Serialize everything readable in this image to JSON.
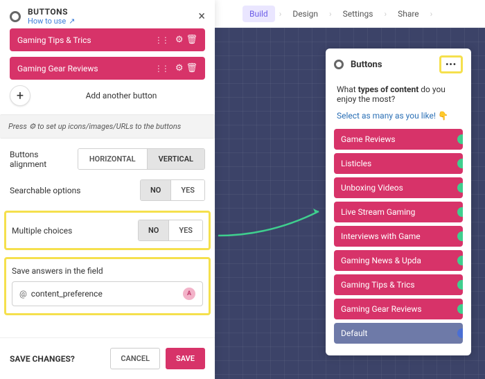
{
  "sidebar": {
    "title": "BUTTONS",
    "howToUse": "How to use",
    "buttons": [
      {
        "label": "Gaming Tips & Trics"
      },
      {
        "label": "Gaming Gear Reviews"
      }
    ],
    "addAnother": "Add another button",
    "hint": "Press ⚙ to set up icons/images/URLs to the buttons",
    "alignment": {
      "label": "Buttons alignment",
      "options": [
        "HORIZONTAL",
        "VERTICAL"
      ],
      "selected": "VERTICAL"
    },
    "searchable": {
      "label": "Searchable options",
      "options": [
        "NO",
        "YES"
      ],
      "selected": "NO"
    },
    "multiple": {
      "label": "Multiple choices",
      "options": [
        "NO",
        "YES"
      ],
      "selected": "YES"
    },
    "saveField": {
      "label": "Save answers in the field",
      "value": "content_preference",
      "badge": "A"
    },
    "footer": {
      "question": "SAVE CHANGES?",
      "cancel": "CANCEL",
      "save": "SAVE"
    }
  },
  "topbar": {
    "tabs": [
      "Build",
      "Design",
      "Settings",
      "Share"
    ],
    "active": "Build"
  },
  "card": {
    "title": "Buttons",
    "question_prefix": "What ",
    "question_bold": "types of content",
    "question_suffix": " do you enjoy the most?",
    "subtext": "Select as many as you like! 👇",
    "options": [
      "Game Reviews",
      "Listicles",
      "Unboxing Videos",
      "Live Stream Gaming",
      "Interviews with Game",
      "Gaming News & Upda",
      "Gaming Tips & Trics",
      "Gaming Gear Reviews"
    ],
    "defaultLabel": "Default"
  }
}
